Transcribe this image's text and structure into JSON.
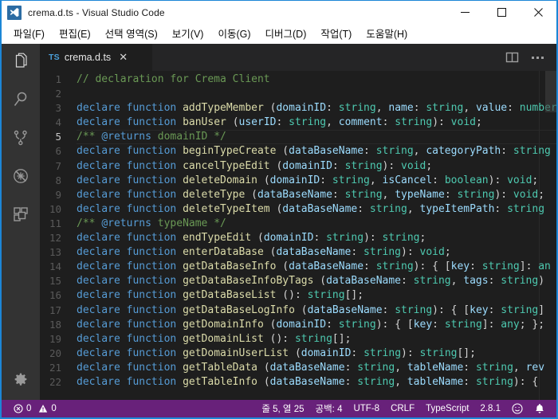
{
  "window": {
    "title": "crema.d.ts - Visual Studio Code",
    "app_icon": "vscode-logo-icon",
    "controls": {
      "minimize": "minimize-icon",
      "maximize": "maximize-icon",
      "close": "close-icon"
    }
  },
  "menubar": {
    "items": [
      {
        "label": "파일(F)"
      },
      {
        "label": "편집(E)"
      },
      {
        "label": "선택 영역(S)"
      },
      {
        "label": "보기(V)"
      },
      {
        "label": "이동(G)"
      },
      {
        "label": "디버그(D)"
      },
      {
        "label": "작업(T)"
      },
      {
        "label": "도움말(H)"
      }
    ]
  },
  "activitybar": {
    "items": [
      {
        "name": "explorer",
        "icon": "files-icon",
        "active": true
      },
      {
        "name": "search",
        "icon": "search-icon",
        "active": false
      },
      {
        "name": "source-control",
        "icon": "source-control-branch-icon",
        "active": false
      },
      {
        "name": "debug",
        "icon": "debug-no-bug-icon",
        "active": false
      },
      {
        "name": "extensions",
        "icon": "extensions-icon",
        "active": false
      }
    ],
    "bottom": {
      "name": "manage",
      "icon": "gear-icon"
    }
  },
  "tabs": {
    "open": [
      {
        "badge": "TS",
        "label": "crema.d.ts",
        "close": "✕",
        "active": true
      }
    ],
    "actions": {
      "split_editor": "split-editor-icon",
      "more": "more-actions-icon"
    }
  },
  "editor": {
    "lines": [
      {
        "n": "1",
        "tokens": [
          [
            "c-comment",
            "// declaration for Crema Client"
          ]
        ]
      },
      {
        "n": "2",
        "tokens": [
          [
            "c-plain",
            ""
          ]
        ]
      },
      {
        "n": "3",
        "tokens": [
          [
            "c-kw",
            "declare function "
          ],
          [
            "c-fn",
            "addTypeMember "
          ],
          [
            "c-punc",
            "("
          ],
          [
            "c-param",
            "domainID"
          ],
          [
            "c-punc",
            ": "
          ],
          [
            "c-type",
            "string"
          ],
          [
            "c-punc",
            ", "
          ],
          [
            "c-param",
            "name"
          ],
          [
            "c-punc",
            ": "
          ],
          [
            "c-type",
            "string"
          ],
          [
            "c-punc",
            ", "
          ],
          [
            "c-param",
            "value"
          ],
          [
            "c-punc",
            ": "
          ],
          [
            "c-type",
            "number"
          ]
        ]
      },
      {
        "n": "4",
        "tokens": [
          [
            "c-kw",
            "declare function "
          ],
          [
            "c-fn",
            "banUser "
          ],
          [
            "c-punc",
            "("
          ],
          [
            "c-param",
            "userID"
          ],
          [
            "c-punc",
            ": "
          ],
          [
            "c-type",
            "string"
          ],
          [
            "c-punc",
            ", "
          ],
          [
            "c-param",
            "comment"
          ],
          [
            "c-punc",
            ": "
          ],
          [
            "c-type",
            "string"
          ],
          [
            "c-punc",
            "): "
          ],
          [
            "c-type",
            "void"
          ],
          [
            "c-punc",
            ";"
          ]
        ]
      },
      {
        "n": "5",
        "current": true,
        "tokens": [
          [
            "c-doc",
            "/** "
          ],
          [
            "c-docTag",
            "@returns"
          ],
          [
            "c-doc",
            " domainID */"
          ]
        ]
      },
      {
        "n": "6",
        "tokens": [
          [
            "c-kw",
            "declare function "
          ],
          [
            "c-fn",
            "beginTypeCreate "
          ],
          [
            "c-punc",
            "("
          ],
          [
            "c-param",
            "dataBaseName"
          ],
          [
            "c-punc",
            ": "
          ],
          [
            "c-type",
            "string"
          ],
          [
            "c-punc",
            ", "
          ],
          [
            "c-param",
            "categoryPath"
          ],
          [
            "c-punc",
            ": "
          ],
          [
            "c-type",
            "string"
          ]
        ]
      },
      {
        "n": "7",
        "tokens": [
          [
            "c-kw",
            "declare function "
          ],
          [
            "c-fn",
            "cancelTypeEdit "
          ],
          [
            "c-punc",
            "("
          ],
          [
            "c-param",
            "domainID"
          ],
          [
            "c-punc",
            ": "
          ],
          [
            "c-type",
            "string"
          ],
          [
            "c-punc",
            "): "
          ],
          [
            "c-type",
            "void"
          ],
          [
            "c-punc",
            ";"
          ]
        ]
      },
      {
        "n": "8",
        "tokens": [
          [
            "c-kw",
            "declare function "
          ],
          [
            "c-fn",
            "deleteDomain "
          ],
          [
            "c-punc",
            "("
          ],
          [
            "c-param",
            "domainID"
          ],
          [
            "c-punc",
            ": "
          ],
          [
            "c-type",
            "string"
          ],
          [
            "c-punc",
            ", "
          ],
          [
            "c-param",
            "isCancel"
          ],
          [
            "c-punc",
            ": "
          ],
          [
            "c-type",
            "boolean"
          ],
          [
            "c-punc",
            "): "
          ],
          [
            "c-type",
            "void"
          ],
          [
            "c-punc",
            ";"
          ]
        ]
      },
      {
        "n": "9",
        "tokens": [
          [
            "c-kw",
            "declare function "
          ],
          [
            "c-fn",
            "deleteType "
          ],
          [
            "c-punc",
            "("
          ],
          [
            "c-param",
            "dataBaseName"
          ],
          [
            "c-punc",
            ": "
          ],
          [
            "c-type",
            "string"
          ],
          [
            "c-punc",
            ", "
          ],
          [
            "c-param",
            "typeName"
          ],
          [
            "c-punc",
            ": "
          ],
          [
            "c-type",
            "string"
          ],
          [
            "c-punc",
            "): "
          ],
          [
            "c-type",
            "void"
          ],
          [
            "c-punc",
            ";"
          ]
        ]
      },
      {
        "n": "10",
        "tokens": [
          [
            "c-kw",
            "declare function "
          ],
          [
            "c-fn",
            "deleteTypeItem "
          ],
          [
            "c-punc",
            "("
          ],
          [
            "c-param",
            "dataBaseName"
          ],
          [
            "c-punc",
            ": "
          ],
          [
            "c-type",
            "string"
          ],
          [
            "c-punc",
            ", "
          ],
          [
            "c-param",
            "typeItemPath"
          ],
          [
            "c-punc",
            ": "
          ],
          [
            "c-type",
            "string"
          ]
        ]
      },
      {
        "n": "11",
        "tokens": [
          [
            "c-doc",
            "/** "
          ],
          [
            "c-docTag",
            "@returns"
          ],
          [
            "c-doc",
            " typeName */"
          ]
        ]
      },
      {
        "n": "12",
        "tokens": [
          [
            "c-kw",
            "declare function "
          ],
          [
            "c-fn",
            "endTypeEdit "
          ],
          [
            "c-punc",
            "("
          ],
          [
            "c-param",
            "domainID"
          ],
          [
            "c-punc",
            ": "
          ],
          [
            "c-type",
            "string"
          ],
          [
            "c-punc",
            "): "
          ],
          [
            "c-type",
            "string"
          ],
          [
            "c-punc",
            ";"
          ]
        ]
      },
      {
        "n": "13",
        "tokens": [
          [
            "c-kw",
            "declare function "
          ],
          [
            "c-fn",
            "enterDataBase "
          ],
          [
            "c-punc",
            "("
          ],
          [
            "c-param",
            "dataBaseName"
          ],
          [
            "c-punc",
            ": "
          ],
          [
            "c-type",
            "string"
          ],
          [
            "c-punc",
            "): "
          ],
          [
            "c-type",
            "void"
          ],
          [
            "c-punc",
            ";"
          ]
        ]
      },
      {
        "n": "14",
        "tokens": [
          [
            "c-kw",
            "declare function "
          ],
          [
            "c-fn",
            "getDataBaseInfo "
          ],
          [
            "c-punc",
            "("
          ],
          [
            "c-param",
            "dataBaseName"
          ],
          [
            "c-punc",
            ": "
          ],
          [
            "c-type",
            "string"
          ],
          [
            "c-punc",
            "): { ["
          ],
          [
            "c-param",
            "key"
          ],
          [
            "c-punc",
            ": "
          ],
          [
            "c-type",
            "string"
          ],
          [
            "c-punc",
            "]: "
          ],
          [
            "c-type",
            "an"
          ]
        ]
      },
      {
        "n": "15",
        "tokens": [
          [
            "c-kw",
            "declare function "
          ],
          [
            "c-fn",
            "getDataBaseInfoByTags "
          ],
          [
            "c-punc",
            "("
          ],
          [
            "c-param",
            "dataBaseName"
          ],
          [
            "c-punc",
            ": "
          ],
          [
            "c-type",
            "string"
          ],
          [
            "c-punc",
            ", "
          ],
          [
            "c-param",
            "tags"
          ],
          [
            "c-punc",
            ": "
          ],
          [
            "c-type",
            "string"
          ],
          [
            "c-punc",
            ")"
          ]
        ]
      },
      {
        "n": "16",
        "tokens": [
          [
            "c-kw",
            "declare function "
          ],
          [
            "c-fn",
            "getDataBaseList "
          ],
          [
            "c-punc",
            "(): "
          ],
          [
            "c-type",
            "string"
          ],
          [
            "c-punc",
            "[];"
          ]
        ]
      },
      {
        "n": "17",
        "tokens": [
          [
            "c-kw",
            "declare function "
          ],
          [
            "c-fn",
            "getDataBaseLogInfo "
          ],
          [
            "c-punc",
            "("
          ],
          [
            "c-param",
            "dataBaseName"
          ],
          [
            "c-punc",
            ": "
          ],
          [
            "c-type",
            "string"
          ],
          [
            "c-punc",
            "): { ["
          ],
          [
            "c-param",
            "key"
          ],
          [
            "c-punc",
            ": "
          ],
          [
            "c-type",
            "string"
          ],
          [
            "c-punc",
            "]"
          ]
        ]
      },
      {
        "n": "18",
        "tokens": [
          [
            "c-kw",
            "declare function "
          ],
          [
            "c-fn",
            "getDomainInfo "
          ],
          [
            "c-punc",
            "("
          ],
          [
            "c-param",
            "domainID"
          ],
          [
            "c-punc",
            ": "
          ],
          [
            "c-type",
            "string"
          ],
          [
            "c-punc",
            "): { ["
          ],
          [
            "c-param",
            "key"
          ],
          [
            "c-punc",
            ": "
          ],
          [
            "c-type",
            "string"
          ],
          [
            "c-punc",
            "]: "
          ],
          [
            "c-type",
            "any"
          ],
          [
            "c-punc",
            "; };"
          ]
        ]
      },
      {
        "n": "19",
        "tokens": [
          [
            "c-kw",
            "declare function "
          ],
          [
            "c-fn",
            "getDomainList "
          ],
          [
            "c-punc",
            "(): "
          ],
          [
            "c-type",
            "string"
          ],
          [
            "c-punc",
            "[];"
          ]
        ]
      },
      {
        "n": "20",
        "tokens": [
          [
            "c-kw",
            "declare function "
          ],
          [
            "c-fn",
            "getDomainUserList "
          ],
          [
            "c-punc",
            "("
          ],
          [
            "c-param",
            "domainID"
          ],
          [
            "c-punc",
            ": "
          ],
          [
            "c-type",
            "string"
          ],
          [
            "c-punc",
            "): "
          ],
          [
            "c-type",
            "string"
          ],
          [
            "c-punc",
            "[];"
          ]
        ]
      },
      {
        "n": "21",
        "tokens": [
          [
            "c-kw",
            "declare function "
          ],
          [
            "c-fn",
            "getTableData "
          ],
          [
            "c-punc",
            "("
          ],
          [
            "c-param",
            "dataBaseName"
          ],
          [
            "c-punc",
            ": "
          ],
          [
            "c-type",
            "string"
          ],
          [
            "c-punc",
            ", "
          ],
          [
            "c-param",
            "tableName"
          ],
          [
            "c-punc",
            ": "
          ],
          [
            "c-type",
            "string"
          ],
          [
            "c-punc",
            ", "
          ],
          [
            "c-param",
            "rev"
          ]
        ]
      },
      {
        "n": "22",
        "tokens": [
          [
            "c-kw",
            "declare function "
          ],
          [
            "c-fn",
            "getTableInfo "
          ],
          [
            "c-punc",
            "("
          ],
          [
            "c-param",
            "dataBaseName"
          ],
          [
            "c-punc",
            ": "
          ],
          [
            "c-type",
            "string"
          ],
          [
            "c-punc",
            ", "
          ],
          [
            "c-param",
            "tableName"
          ],
          [
            "c-punc",
            ": "
          ],
          [
            "c-type",
            "string"
          ],
          [
            "c-punc",
            "): {"
          ]
        ]
      }
    ]
  },
  "statusbar": {
    "errors_icon": "error-circle-icon",
    "errors": "0",
    "warnings_icon": "warning-triangle-icon",
    "warnings": "0",
    "cursor": "줄 5, 열 25",
    "indent": "공백: 4",
    "encoding": "UTF-8",
    "eol": "CRLF",
    "language": "TypeScript",
    "version": "2.8.1",
    "feedback_icon": "smiley-icon",
    "bell_icon": "bell-icon"
  },
  "colors": {
    "accent_border": "#1c86d6",
    "statusbar_bg": "#68217a",
    "activitybar_bg": "#333333",
    "editor_bg": "#1e1e1e",
    "tabbar_bg": "#252526"
  }
}
